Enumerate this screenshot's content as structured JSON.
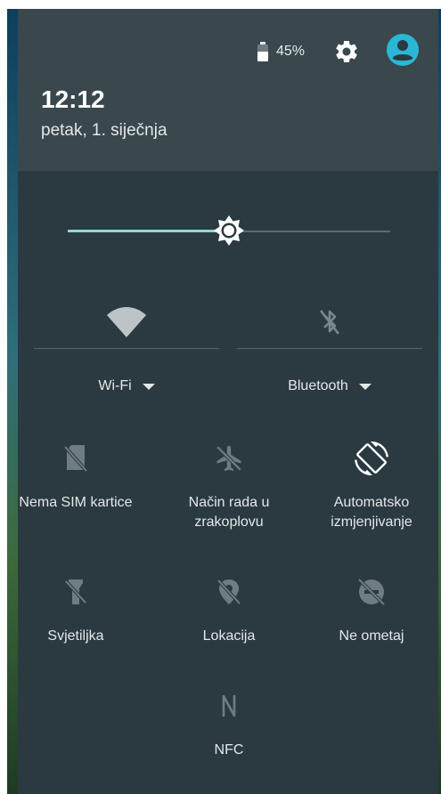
{
  "status": {
    "battery_percent": "45%",
    "battery_level": 0.45
  },
  "header": {
    "time": "12:12",
    "date": "petak, 1. siječnja"
  },
  "brightness": {
    "level": 0.5
  },
  "connections": {
    "wifi_label": "Wi-Fi",
    "bluetooth_label": "Bluetooth"
  },
  "tiles": [
    {
      "label": "Nema SIM kartice",
      "icon": "no-sim-icon",
      "active": false
    },
    {
      "label": "Način rada u zrakoplovu",
      "icon": "airplane-icon",
      "active": false
    },
    {
      "label": "Automatsko izmjenjivanje",
      "icon": "auto-rotate-icon",
      "active": true
    },
    {
      "label": "Svjetiljka",
      "icon": "flashlight-off-icon",
      "active": false
    },
    {
      "label": "Lokacija",
      "icon": "location-off-icon",
      "active": false
    },
    {
      "label": "Ne ometaj",
      "icon": "do-not-disturb-off-icon",
      "active": false
    },
    {
      "label": "NFC",
      "icon": "nfc-icon",
      "active": false
    }
  ],
  "colors": {
    "panel": "#2b3a41",
    "header": "#3a484e",
    "accent": "#8fd8cf",
    "avatar": "#2ab7d6",
    "inactive_icon": "#6f7c82"
  }
}
